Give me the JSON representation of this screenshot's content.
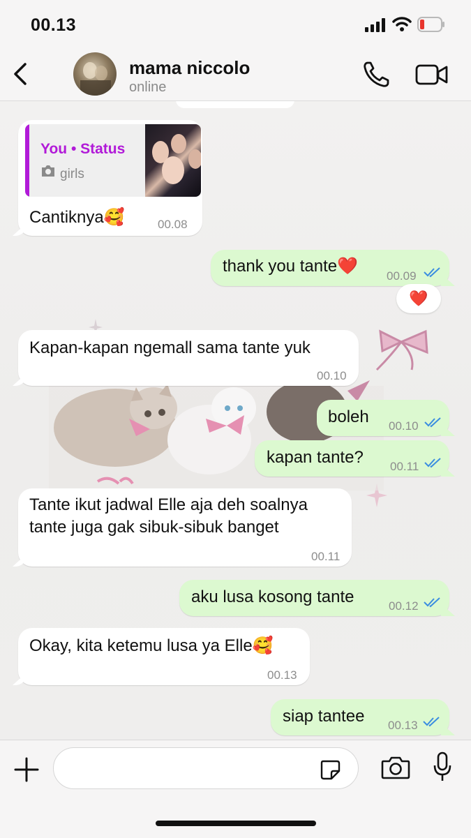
{
  "status_bar": {
    "time": "00.13"
  },
  "header": {
    "contact_name": "mama niccolo",
    "contact_status": "online"
  },
  "messages": [
    {
      "direction": "in",
      "quoted": {
        "title": "You • Status",
        "subtitle": "girls"
      },
      "text": "Cantiknya🥰",
      "time": "00.08"
    },
    {
      "direction": "out",
      "text": "thank you tante❤️",
      "time": "00.09",
      "read": true,
      "reaction": "❤️"
    },
    {
      "direction": "in",
      "text": "Kapan-kapan ngemall sama tante yuk",
      "time": "00.10"
    },
    {
      "direction": "out",
      "text": "boleh",
      "time": "00.10",
      "read": true
    },
    {
      "direction": "out",
      "text": "kapan tante?",
      "time": "00.11",
      "read": true
    },
    {
      "direction": "in",
      "text_lines": [
        "Tante ikut jadwal Elle aja deh soalnya",
        "tante juga gak sibuk-sibuk banget"
      ],
      "time": "00.11"
    },
    {
      "direction": "out",
      "text": "aku lusa kosong tante",
      "time": "00.12",
      "read": true
    },
    {
      "direction": "in",
      "text": "Okay, kita ketemu lusa ya Elle🥰",
      "time": "00.13"
    },
    {
      "direction": "out",
      "text": "siap tantee",
      "time": "00.13",
      "read": true
    }
  ],
  "composer": {
    "placeholder": ""
  },
  "icons": [
    "back-icon",
    "call-icon",
    "video-call-icon",
    "plus-icon",
    "sticker-icon",
    "camera-icon",
    "mic-icon",
    "double-check-icon"
  ],
  "colors": {
    "outgoing_bubble": "#dcf9d0",
    "incoming_bubble": "#ffffff",
    "status_accent": "#b11ad8",
    "read_ticks": "#3b8de0"
  }
}
